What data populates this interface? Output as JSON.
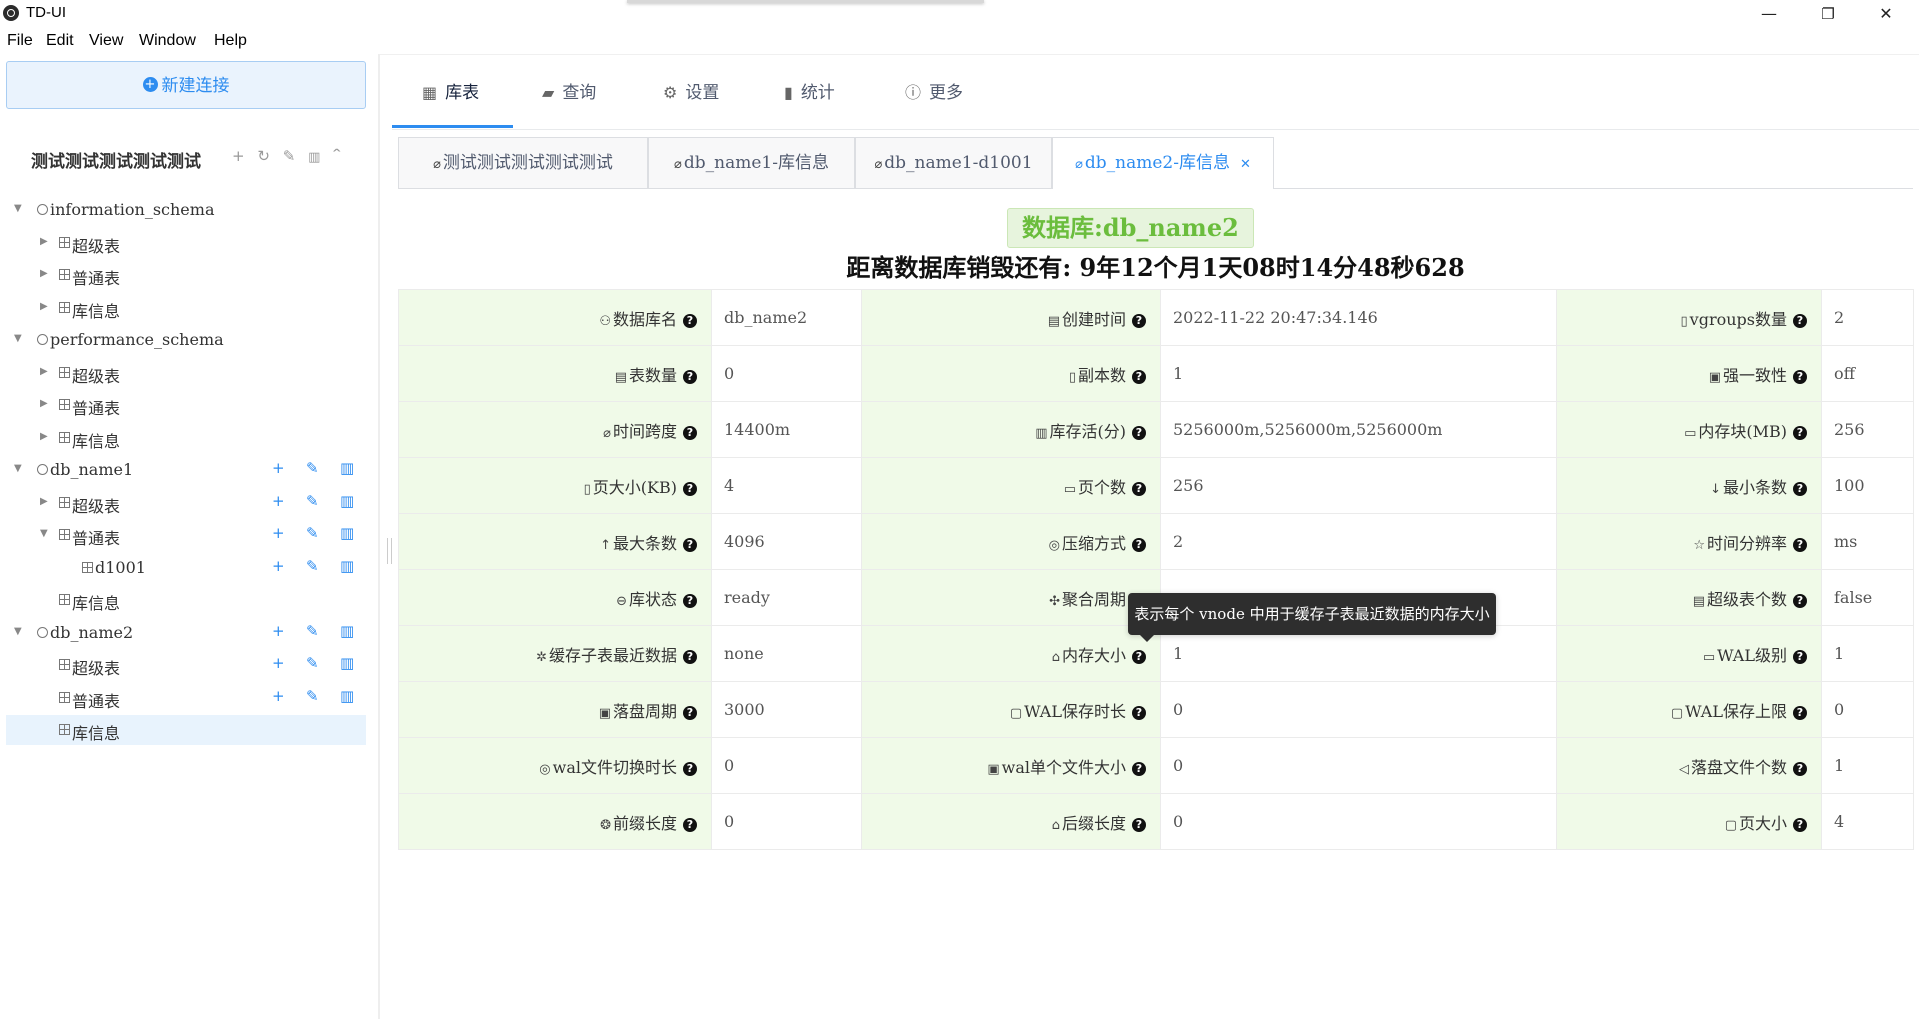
{
  "window": {
    "title": "TD-UI",
    "minimize": "—",
    "restore": "❐",
    "close": "✕"
  },
  "menu": [
    "File",
    "Edit",
    "Window",
    "Help",
    "View"
  ],
  "sidebar": {
    "new_connection": "新建连接",
    "connection_name": "测试测试测试测试测试",
    "tools": [
      "+",
      "↻",
      "✎",
      "🗑",
      "^"
    ],
    "tree": [
      {
        "label": "information_schema",
        "kind": "db"
      },
      {
        "label": "超级表",
        "kind": "tbl"
      },
      {
        "label": "普通表",
        "kind": "tbl"
      },
      {
        "label": "库信息",
        "kind": "tbl"
      },
      {
        "label": "performance_schema",
        "kind": "db"
      },
      {
        "label": "超级表",
        "kind": "tbl"
      },
      {
        "label": "普通表",
        "kind": "tbl"
      },
      {
        "label": "库信息",
        "kind": "tbl"
      },
      {
        "label": "db_name1",
        "kind": "db"
      },
      {
        "label": "超级表",
        "kind": "tbl"
      },
      {
        "label": "普通表",
        "kind": "tbl"
      },
      {
        "label": "d1001",
        "kind": "tbl"
      },
      {
        "label": "库信息",
        "kind": "tbl"
      },
      {
        "label": "db_name2",
        "kind": "db"
      },
      {
        "label": "超级表",
        "kind": "tbl"
      },
      {
        "label": "普通表",
        "kind": "tbl"
      },
      {
        "label": "库信息",
        "kind": "tbl"
      }
    ]
  },
  "main_tabs": [
    "库表",
    "查询",
    "设置",
    "统计",
    "更多"
  ],
  "sub_tabs": [
    "测试测试测试测试测试",
    "db_name1-库信息",
    "db_name1-d1001",
    "db_name2-库信息"
  ],
  "header": {
    "db_title": "数据库:db_name2",
    "countdown": "距离数据库销毁还有: 9年12个月1天08时14分48秒628"
  },
  "rows": [
    [
      [
        "数据库名",
        "db_name2"
      ],
      [
        "创建时间",
        "2022-11-22 20:47:34.146"
      ],
      [
        "vgroups数量",
        "2"
      ]
    ],
    [
      [
        "表数量",
        "0"
      ],
      [
        "副本数",
        "1"
      ],
      [
        "强一致性",
        "off"
      ]
    ],
    [
      [
        "时间跨度",
        "14400m"
      ],
      [
        "库存活(分)",
        "5256000m,5256000m,5256000m"
      ],
      [
        "内存块(MB)",
        "256"
      ]
    ],
    [
      [
        "页大小(KB)",
        "4"
      ],
      [
        "页个数",
        "256"
      ],
      [
        "最小条数",
        "100"
      ]
    ],
    [
      [
        "最大条数",
        "4096"
      ],
      [
        "压缩方式",
        "2"
      ],
      [
        "时间分辨率",
        "ms"
      ]
    ],
    [
      [
        "库状态",
        "ready"
      ],
      [
        "聚合周期",
        ""
      ],
      [
        "超级表个数",
        "false"
      ]
    ],
    [
      [
        "缓存子表最近数据",
        "none"
      ],
      [
        "内存大小",
        "1"
      ],
      [
        "WAL级别",
        "1"
      ]
    ],
    [
      [
        "落盘周期",
        "3000"
      ],
      [
        "WAL保存时长",
        "0"
      ],
      [
        "WAL保存上限",
        "0"
      ]
    ],
    [
      [
        "wal文件切换时长",
        "0"
      ],
      [
        "wal单个文件大小",
        "0"
      ],
      [
        "落盘文件个数",
        "1"
      ]
    ],
    [
      [
        "前缀长度",
        "0"
      ],
      [
        "后缀长度",
        "0"
      ],
      [
        "页大小",
        "4"
      ]
    ]
  ],
  "tooltip": "表示每个 vnode 中用于缓存子表最近数据的内存大小",
  "colors": {
    "accent": "#2d8cf0",
    "key_bg": "#f0fae8",
    "badge_text": "#6bbd3d"
  }
}
